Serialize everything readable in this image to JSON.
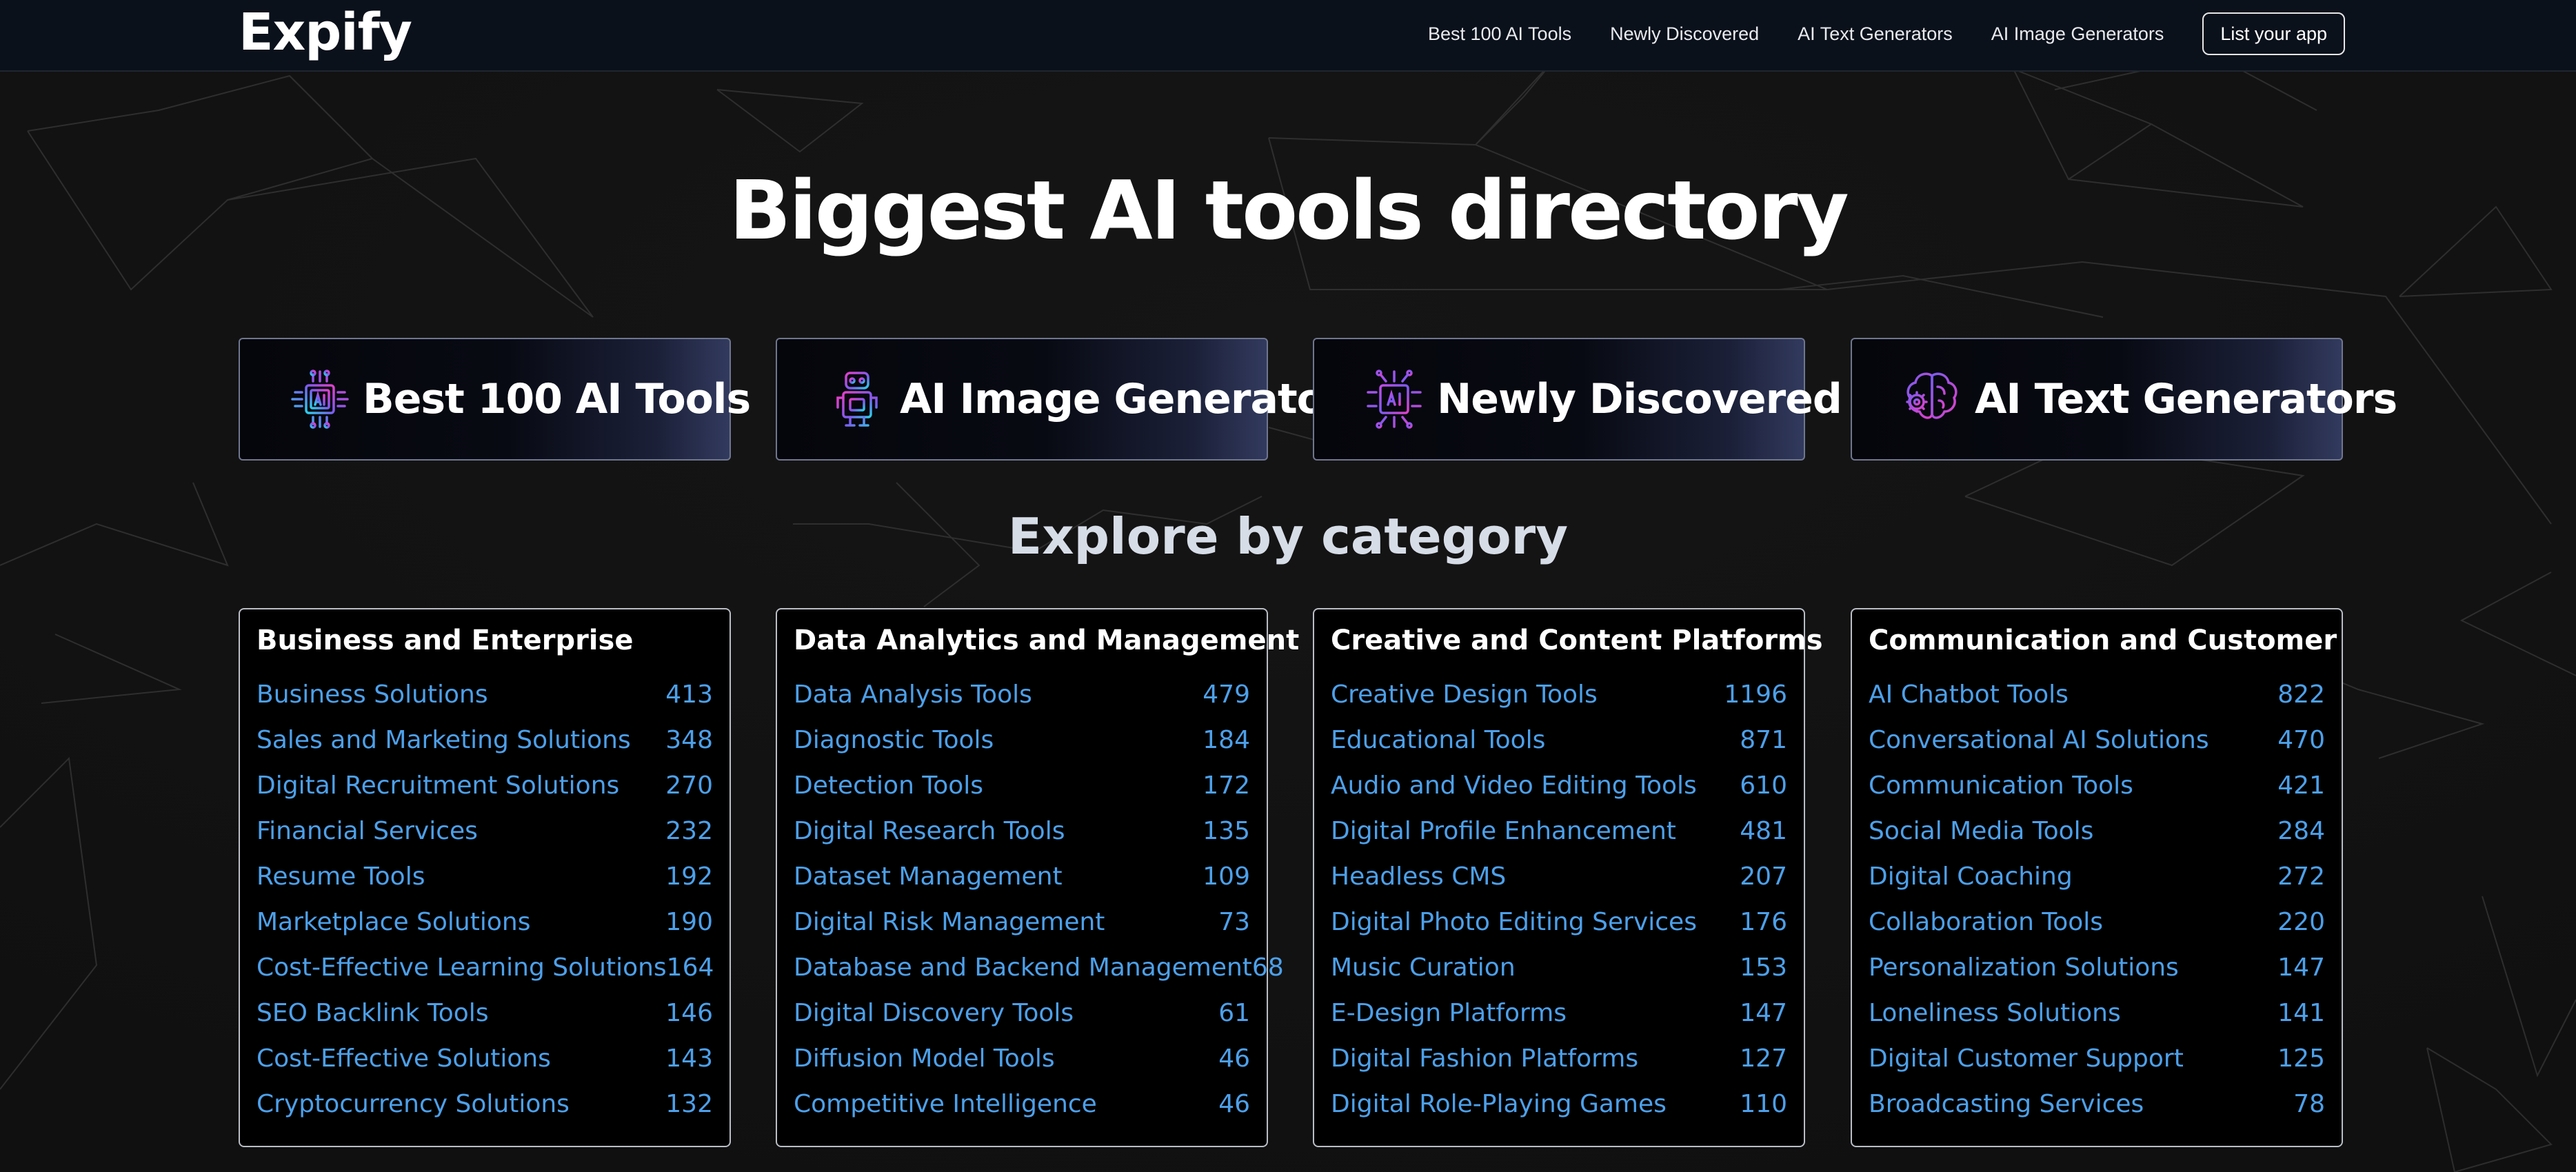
{
  "brand": {
    "name": "Expify"
  },
  "nav": {
    "links": [
      "Best 100 AI Tools",
      "Newly Discovered",
      "AI Text Generators",
      "AI Image Generators"
    ],
    "cta": "List your app"
  },
  "hero": {
    "title": "Biggest AI tools directory"
  },
  "featured": [
    {
      "label": "Best 100 AI Tools",
      "icon": "ai-chip-icon"
    },
    {
      "label": "AI Image Generators",
      "icon": "robot-icon"
    },
    {
      "label": "Newly Discovered",
      "icon": "ai-chip-icon"
    },
    {
      "label": "AI Text Generators",
      "icon": "brain-gear-icon"
    }
  ],
  "explore": {
    "title": "Explore by category"
  },
  "colors": {
    "link": "#4da0ea",
    "background": "#121212",
    "navbar": "#0b111b",
    "icon_gradient": [
      "#2bd0e8",
      "#7b5cf0",
      "#e040c8"
    ]
  },
  "categories": [
    {
      "title": "Business and Enterprise",
      "items": [
        {
          "name": "Business Solutions",
          "count": "413"
        },
        {
          "name": "Sales and Marketing Solutions",
          "count": "348"
        },
        {
          "name": "Digital Recruitment Solutions",
          "count": "270"
        },
        {
          "name": "Financial Services",
          "count": "232"
        },
        {
          "name": "Resume Tools",
          "count": "192"
        },
        {
          "name": "Marketplace Solutions",
          "count": "190"
        },
        {
          "name": "Cost-Effective Learning Solutions",
          "count": "164"
        },
        {
          "name": "SEO Backlink Tools",
          "count": "146"
        },
        {
          "name": "Cost-Effective Solutions",
          "count": "143"
        },
        {
          "name": "Cryptocurrency Solutions",
          "count": "132"
        }
      ]
    },
    {
      "title": "Data Analytics and Management",
      "items": [
        {
          "name": "Data Analysis Tools",
          "count": "479"
        },
        {
          "name": "Diagnostic Tools",
          "count": "184"
        },
        {
          "name": "Detection Tools",
          "count": "172"
        },
        {
          "name": "Digital Research Tools",
          "count": "135"
        },
        {
          "name": "Dataset Management",
          "count": "109"
        },
        {
          "name": "Digital Risk Management",
          "count": "73"
        },
        {
          "name": "Database and Backend Management",
          "count": "68"
        },
        {
          "name": "Digital Discovery Tools",
          "count": "61"
        },
        {
          "name": "Diffusion Model Tools",
          "count": "46"
        },
        {
          "name": "Competitive Intelligence",
          "count": "46"
        }
      ]
    },
    {
      "title": "Creative and Content Platforms",
      "items": [
        {
          "name": "Creative Design Tools",
          "count": "1196"
        },
        {
          "name": "Educational Tools",
          "count": "871"
        },
        {
          "name": "Audio and Video Editing Tools",
          "count": "610"
        },
        {
          "name": "Digital Profile Enhancement",
          "count": "481"
        },
        {
          "name": "Headless CMS",
          "count": "207"
        },
        {
          "name": "Digital Photo Editing Services",
          "count": "176"
        },
        {
          "name": "Music Curation",
          "count": "153"
        },
        {
          "name": "E-Design Platforms",
          "count": "147"
        },
        {
          "name": "Digital Fashion Platforms",
          "count": "127"
        },
        {
          "name": "Digital Role-Playing Games",
          "count": "110"
        }
      ]
    },
    {
      "title": "Communication and Customer",
      "items": [
        {
          "name": "AI Chatbot Tools",
          "count": "822"
        },
        {
          "name": "Conversational AI Solutions",
          "count": "470"
        },
        {
          "name": "Communication Tools",
          "count": "421"
        },
        {
          "name": "Social Media Tools",
          "count": "284"
        },
        {
          "name": "Digital Coaching",
          "count": "272"
        },
        {
          "name": "Collaboration Tools",
          "count": "220"
        },
        {
          "name": "Personalization Solutions",
          "count": "147"
        },
        {
          "name": "Loneliness Solutions",
          "count": "141"
        },
        {
          "name": "Digital Customer Support",
          "count": "125"
        },
        {
          "name": "Broadcasting Services",
          "count": "78"
        }
      ]
    }
  ]
}
